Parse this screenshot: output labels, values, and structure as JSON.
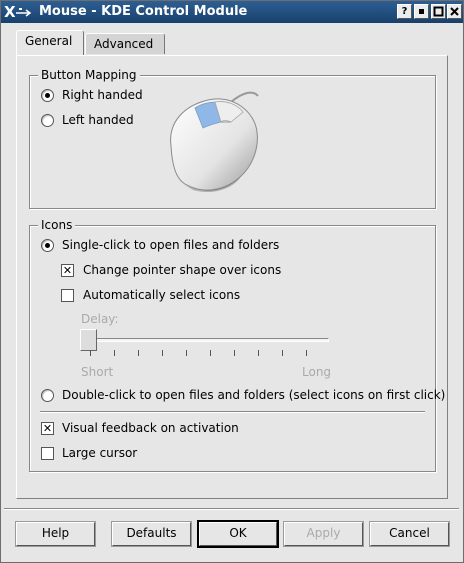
{
  "window": {
    "title": "Mouse - KDE Control Module"
  },
  "titlebar": {
    "buttons": [
      {
        "label": "?",
        "icon": "help-icon"
      },
      {
        "label": "▪",
        "icon": "minimize-icon"
      },
      {
        "label": "□",
        "icon": "maximize-icon"
      },
      {
        "label": "✕",
        "icon": "close-icon"
      }
    ]
  },
  "tabs": [
    {
      "label": "General",
      "active": true
    },
    {
      "label": "Advanced",
      "active": false
    }
  ],
  "button_mapping": {
    "title": "Button Mapping",
    "right_handed": "Right handed",
    "left_handed": "Left handed",
    "selected": "right",
    "image_icon": "mouse-icon"
  },
  "icons": {
    "title": "Icons",
    "single_click": "Single-click to open files and folders",
    "change_pointer": "Change pointer shape over icons",
    "change_pointer_checked": true,
    "auto_select": "Automatically select icons",
    "auto_select_checked": false,
    "delay_label": "Delay:",
    "delay_short": "Short",
    "delay_long": "Long",
    "delay_value": 0,
    "double_click": "Double-click to open files and folders (select icons on first click)",
    "click_mode": "single",
    "visual_feedback": "Visual feedback on activation",
    "visual_feedback_checked": true,
    "large_cursor": "Large cursor",
    "large_cursor_checked": false
  },
  "buttons": {
    "help": "Help",
    "defaults": "Defaults",
    "ok": "OK",
    "apply": "Apply",
    "cancel": "Cancel"
  }
}
